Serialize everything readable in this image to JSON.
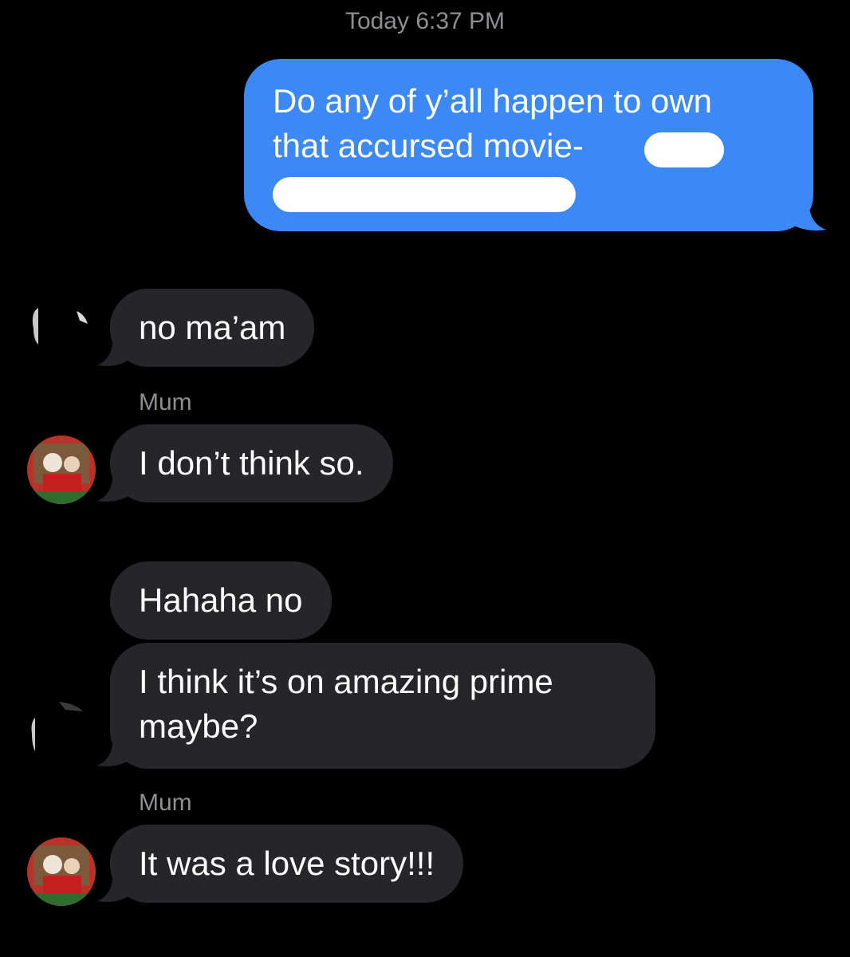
{
  "thread": {
    "timestamp": "Today 6:37 PM",
    "outgoing": {
      "line1": "Do any of y’all happen to own",
      "line2": "that accursed movie-"
    },
    "messages": [
      {
        "text": "no ma’am"
      },
      {
        "sender": "Mum",
        "text": "I don’t think so."
      },
      {
        "text": "Hahaha no"
      },
      {
        "line1": "I think it’s on amazing prime",
        "line2": "maybe?"
      },
      {
        "sender": "Mum",
        "text": "It was a love story!!!"
      }
    ]
  },
  "colors": {
    "background": "#000000",
    "outgoing_bubble": "#3c88f5",
    "incoming_bubble": "#26262a",
    "meta_text": "#8e8e93"
  },
  "icons": {
    "avatar_1": "contact-avatar-redacted",
    "avatar_mum": "contact-avatar-photo",
    "avatar_2": "contact-avatar-redacted"
  }
}
